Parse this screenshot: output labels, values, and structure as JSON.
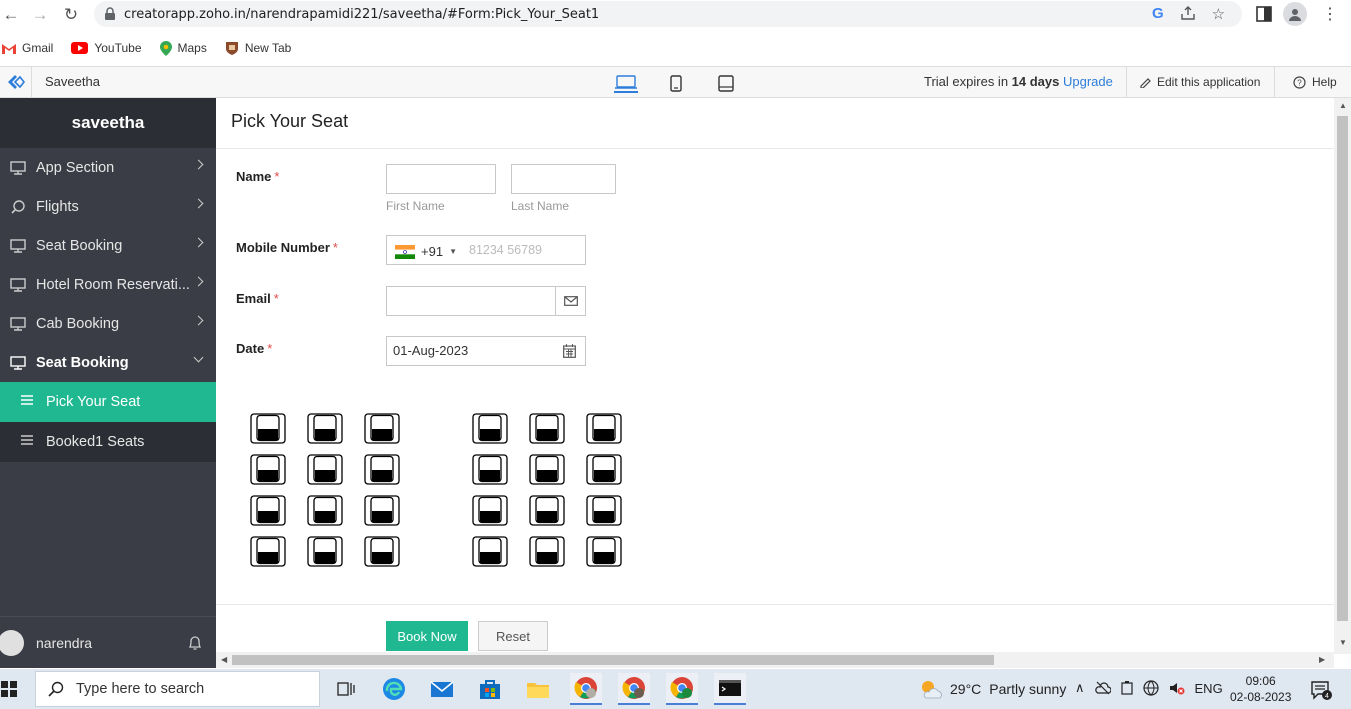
{
  "browser": {
    "url": "creatorapp.zoho.in/narendrapamidi221/saveetha/#Form:Pick_Your_Seat1",
    "bookmarks": [
      {
        "label": "Gmail",
        "icon": "gmail-icon"
      },
      {
        "label": "YouTube",
        "icon": "youtube-icon"
      },
      {
        "label": "Maps",
        "icon": "maps-icon"
      },
      {
        "label": "New Tab",
        "icon": "new-tab-icon"
      }
    ]
  },
  "appbar": {
    "app_name": "Saveetha",
    "trial_prefix": "Trial expires in",
    "trial_days": "14 days",
    "upgrade": "Upgrade",
    "edit": "Edit this application",
    "help": "Help"
  },
  "sidebar": {
    "title": "saveetha",
    "items": [
      {
        "label": "App Section"
      },
      {
        "label": "Flights"
      },
      {
        "label": "Seat Booking"
      },
      {
        "label": "Hotel Room Reservati..."
      },
      {
        "label": "Cab Booking"
      },
      {
        "label": "Seat Booking"
      }
    ],
    "subitems": [
      {
        "label": "Pick Your Seat"
      },
      {
        "label": "Booked1 Seats"
      }
    ],
    "user": "narendra"
  },
  "form": {
    "title": "Pick Your Seat",
    "name_label": "Name",
    "first_name": "First Name",
    "last_name": "Last Name",
    "mobile_label": "Mobile Number",
    "country_code": "+91",
    "mobile_placeholder": "81234 56789",
    "email_label": "Email",
    "date_label": "Date",
    "date_value": "01-Aug-2023",
    "required_mark": "*",
    "book_button": "Book Now",
    "reset_button": "Reset",
    "seat_rows": 4,
    "seats_per_row": 6
  },
  "taskbar": {
    "search_placeholder": "Type here to search",
    "temperature": "29°C",
    "weather": "Partly sunny",
    "language": "ENG",
    "time": "09:06",
    "date": "02-08-2023",
    "notifications": "4"
  }
}
